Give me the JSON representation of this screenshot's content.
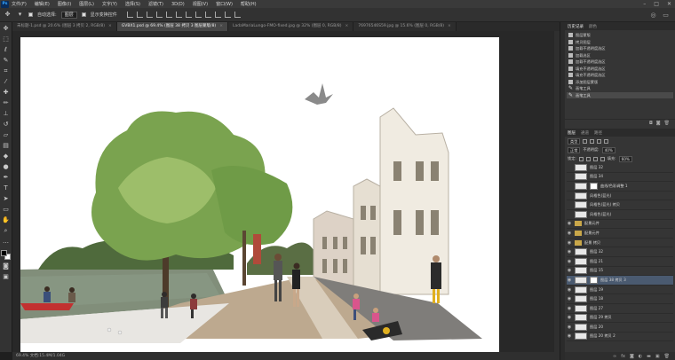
{
  "menubar": {
    "logo": "Ps",
    "items": [
      "文件(F)",
      "编辑(E)",
      "图像(I)",
      "图层(L)",
      "文字(Y)",
      "选择(S)",
      "滤镜(T)",
      "3D(D)",
      "视图(V)",
      "窗口(W)",
      "帮助(H)"
    ]
  },
  "options": {
    "auto_select_label": "自动选择:",
    "auto_select_value": "图层",
    "show_transform_label": "显示变换控件"
  },
  "tabs": [
    {
      "label": "未标题-1.psd @ 20.6% (图层 3 拷贝 2, RGB/8)",
      "active": false
    },
    {
      "label": "GVBX1.psd @ 69.4% (图层 38 拷贝 3 图层蒙版/8)",
      "active": true
    },
    {
      "label": "LadaMariaLungo-FMO-fixed.jpg @ 32% (图层 0, RGB/8)",
      "active": false
    },
    {
      "label": "76976546S59.jpg @ 15.6% (图层 0, RGB/8)",
      "active": false
    }
  ],
  "status_bar": "69.4% 文档:15.4M/1.04G",
  "history": {
    "tabs": [
      "历史记录",
      "颜色"
    ],
    "items": [
      "图层蒙版",
      "拷贝图层",
      "加载不透明度选区",
      "加载选区",
      "加载不透明度选区",
      "填充不透明度选区",
      "填充不透明度选区",
      "添加图层蒙版",
      "画笔工具",
      "画笔工具"
    ]
  },
  "layers_panel": {
    "tabs": [
      "图层",
      "通道",
      "路径"
    ],
    "filter_label": "类型",
    "blend_mode": "正常",
    "opacity_label": "不透明度:",
    "opacity_value": "40%",
    "lock_label": "锁定:",
    "fill_label": "填充:",
    "fill_value": "60%",
    "layers": [
      {
        "name": "图层 32",
        "kind": "layer",
        "visible": false,
        "selected": false,
        "mask": false
      },
      {
        "name": "图层 34",
        "kind": "layer",
        "visible": false,
        "selected": false,
        "mask": false
      },
      {
        "name": "曲线/色彩调整 1",
        "kind": "adjust",
        "visible": false,
        "selected": false,
        "mask": true
      },
      {
        "name": "风格色(蓝光)",
        "kind": "layer",
        "visible": false,
        "selected": false,
        "mask": false
      },
      {
        "name": "风格色(蓝光) 拷贝",
        "kind": "layer",
        "visible": false,
        "selected": false,
        "mask": false
      },
      {
        "name": "风格色(蓝光)",
        "kind": "layer",
        "visible": false,
        "selected": false,
        "mask": false
      },
      {
        "name": "配景元件",
        "kind": "group",
        "visible": true,
        "selected": false,
        "mask": false
      },
      {
        "name": "配景元件",
        "kind": "group",
        "visible": true,
        "selected": false,
        "mask": false
      },
      {
        "name": "配景 拷贝",
        "kind": "group",
        "visible": true,
        "selected": false,
        "mask": false
      },
      {
        "name": "图层 32",
        "kind": "layer",
        "visible": true,
        "selected": false,
        "mask": false
      },
      {
        "name": "图层 21",
        "kind": "layer",
        "visible": true,
        "selected": false,
        "mask": false
      },
      {
        "name": "图层 15",
        "kind": "layer",
        "visible": true,
        "selected": false,
        "mask": false
      },
      {
        "name": "图层 38 拷贝 3",
        "kind": "layer",
        "visible": true,
        "selected": true,
        "mask": true
      },
      {
        "name": "图层 19",
        "kind": "layer",
        "visible": true,
        "selected": false,
        "mask": false
      },
      {
        "name": "图层 18",
        "kind": "layer",
        "visible": true,
        "selected": false,
        "mask": false
      },
      {
        "name": "图层 27",
        "kind": "layer",
        "visible": true,
        "selected": false,
        "mask": false
      },
      {
        "name": "图层 29 拷贝",
        "kind": "layer",
        "visible": true,
        "selected": false,
        "mask": false
      },
      {
        "name": "图层 20",
        "kind": "layer",
        "visible": true,
        "selected": false,
        "mask": false
      },
      {
        "name": "图层 20 拷贝 2",
        "kind": "layer",
        "visible": true,
        "selected": false,
        "mask": false
      }
    ]
  },
  "colors": {
    "chrome_dark": "#1f1f1f",
    "panel": "#353535",
    "selection": "#4a5a70",
    "canvas": "#ffffff"
  }
}
